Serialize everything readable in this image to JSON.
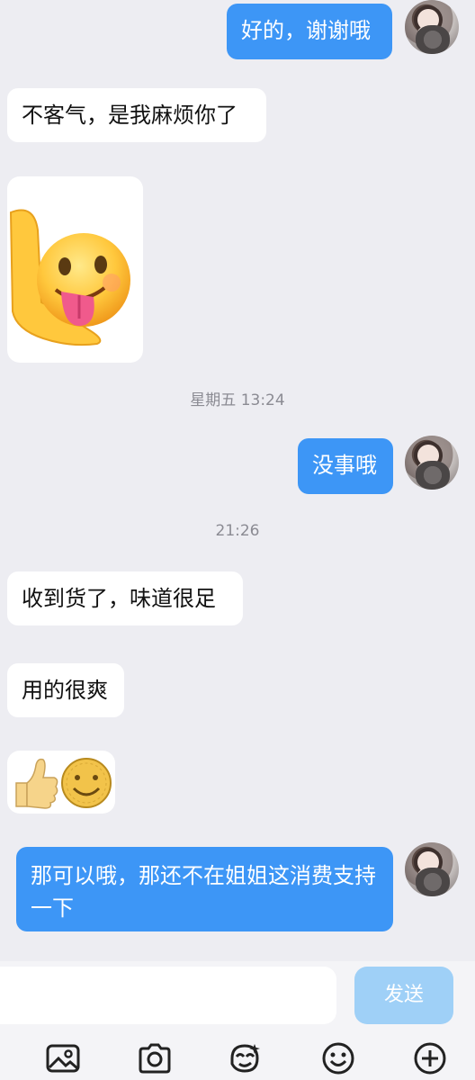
{
  "messages": [
    {
      "side": "mine",
      "text": "好的，谢谢哦"
    },
    {
      "side": "theirs",
      "text": "不客气，是我麻烦你了"
    },
    {
      "side": "theirs",
      "sticker": "tongue-out-emoji-sticker"
    },
    {
      "side": "mine",
      "text": "没事哦"
    },
    {
      "side": "theirs",
      "text": "收到货了，味道很足"
    },
    {
      "side": "theirs",
      "text": "用的很爽"
    },
    {
      "side": "theirs",
      "emojis": [
        "thumbs-up-emoji",
        "smile-emoji"
      ]
    },
    {
      "side": "mine",
      "text": "那可以哦，那还不在姐姐这消费支持一下"
    }
  ],
  "timestamps": [
    "星期五 13:24",
    "21:26"
  ],
  "input": {
    "placeholder": "",
    "send_label": "发送"
  },
  "toolbar": [
    "image-icon",
    "camera-icon",
    "sticker-icon",
    "emoji-icon",
    "plus-icon"
  ],
  "colors": {
    "mine_bubble": "#3d96f6",
    "theirs_bubble": "#ffffff",
    "background": "#ededf2",
    "send_disabled": "#9fd0f7"
  }
}
